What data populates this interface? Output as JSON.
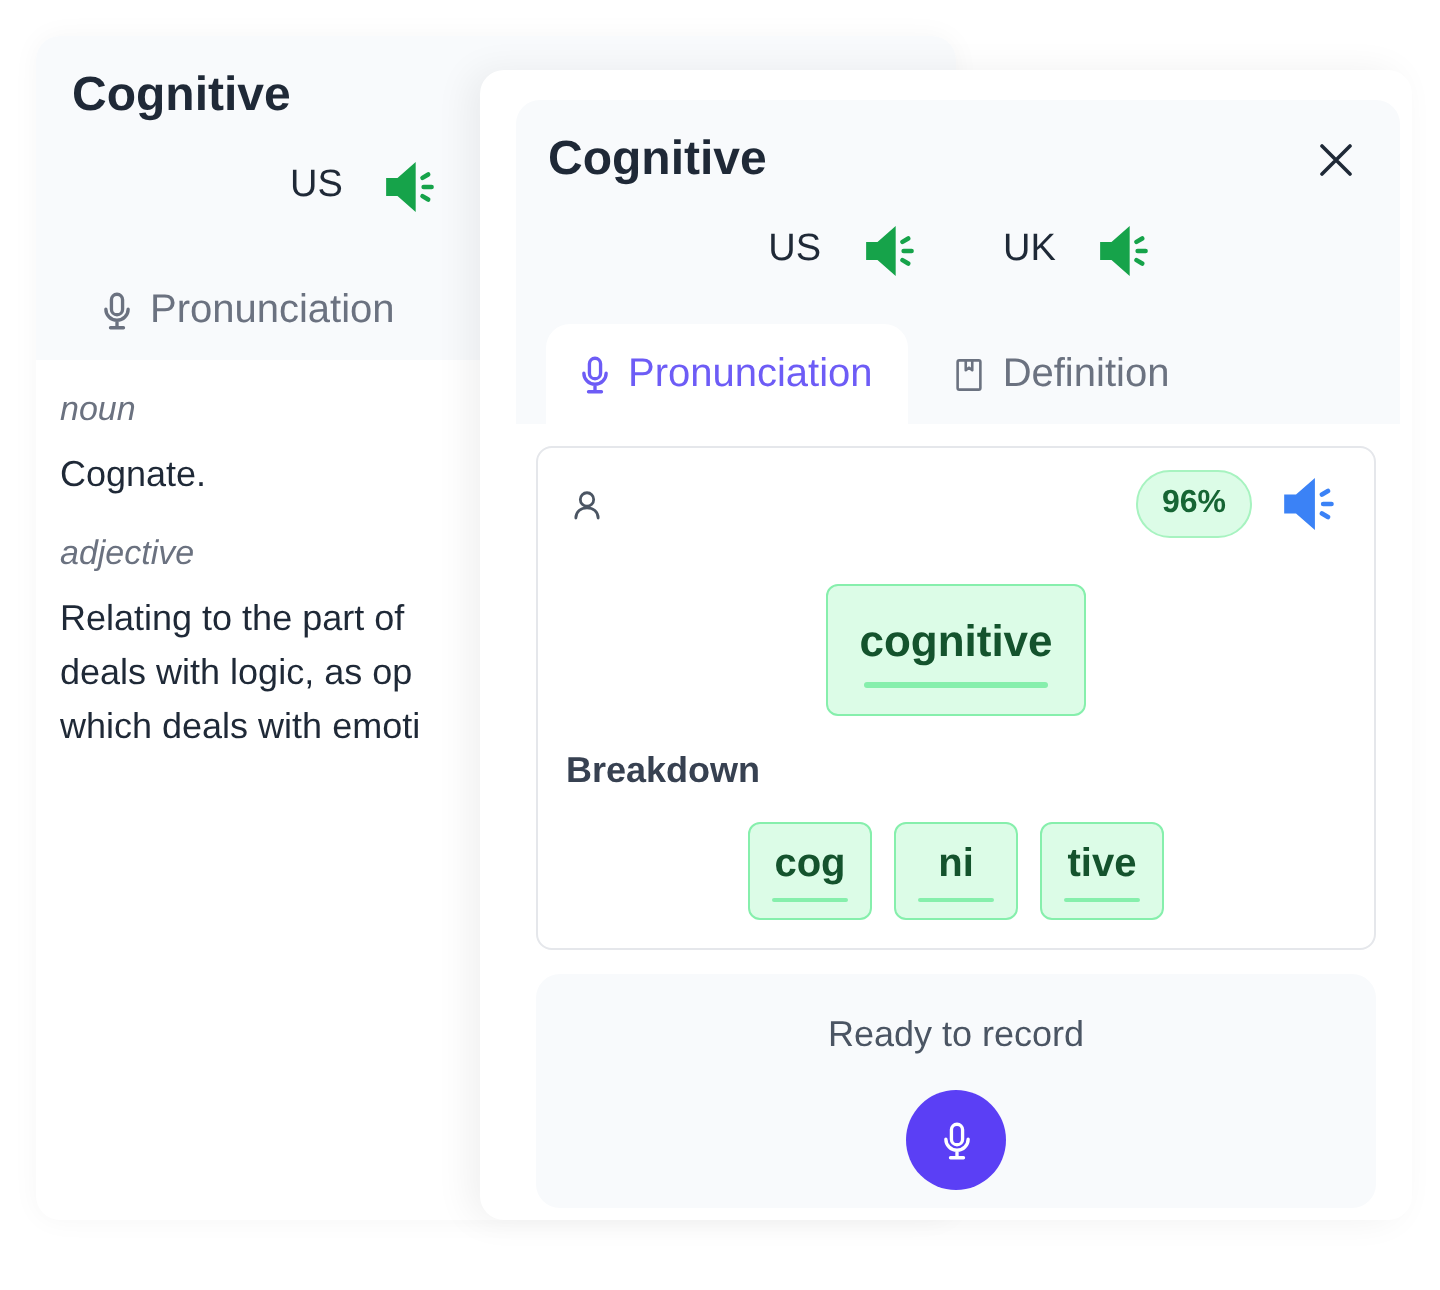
{
  "back_card": {
    "title": "Cognitive",
    "accents": [
      {
        "label": "US"
      }
    ],
    "tabs": [
      {
        "label": "Pronunciation",
        "kind": "mic",
        "selected": false
      }
    ],
    "definitions": [
      {
        "part_of_speech": "noun",
        "lines": [
          "Cognate."
        ]
      },
      {
        "part_of_speech": "adjective",
        "lines": [
          "Relating to the part of",
          "deals with logic, as op",
          "which deals with emoti"
        ]
      }
    ]
  },
  "front_card": {
    "title": "Cognitive",
    "accents": [
      {
        "label": "US"
      },
      {
        "label": "UK"
      }
    ],
    "tabs": [
      {
        "label": "Pronunciation",
        "kind": "mic",
        "selected": true
      },
      {
        "label": "Definition",
        "kind": "book",
        "selected": false
      }
    ],
    "score": "96%",
    "word": "cognitive",
    "breakdown_label": "Breakdown",
    "syllables": [
      "cog",
      "ni",
      "tive"
    ],
    "record_status": "Ready to record"
  }
}
